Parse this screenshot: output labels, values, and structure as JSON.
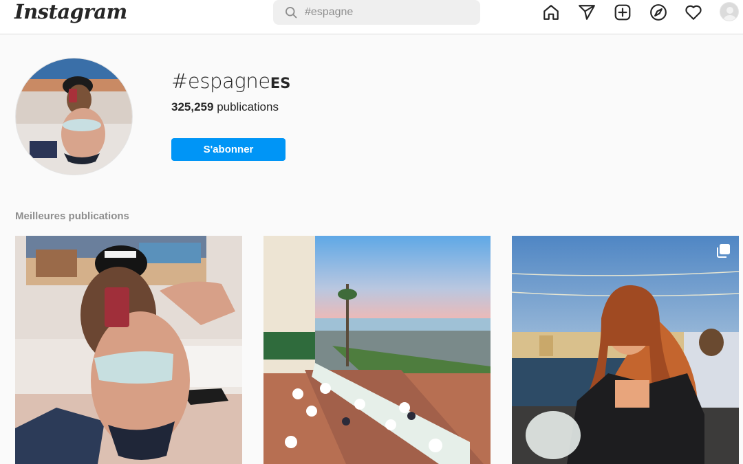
{
  "app": {
    "logo_text": "Instagram"
  },
  "search": {
    "placeholder": "#espagne"
  },
  "nav": {
    "icons": [
      "home-icon",
      "direct-icon",
      "new-post-icon",
      "explore-icon",
      "activity-icon",
      "profile-avatar"
    ]
  },
  "header": {
    "hashtag": "#espagne",
    "language_badge": "ES",
    "posts_count": "325,259",
    "posts_label": "publications",
    "follow_button": "S'abonner"
  },
  "top_posts": {
    "section_title": "Meilleures publications",
    "items": [
      {
        "alt": "Selfie miroir",
        "multi": false
      },
      {
        "alt": "Terrasse au coucher du soleil",
        "multi": false
      },
      {
        "alt": "Femme en veste de cuir",
        "multi": true
      }
    ]
  },
  "colors": {
    "accent": "#0095f6",
    "text": "#262626",
    "muted": "#8e8e8e",
    "background": "#fafafa"
  }
}
